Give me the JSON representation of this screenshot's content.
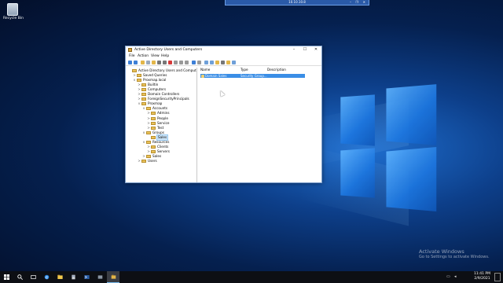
{
  "desktop": {
    "recycle_bin_label": "Recycle Bin"
  },
  "rdp_bar": {
    "title": "10.10.10.8",
    "controls": [
      "–",
      "❐",
      "✕"
    ]
  },
  "window": {
    "title": "Active Directory Users and Computers",
    "menu": [
      "File",
      "Action",
      "View",
      "Help"
    ],
    "tree": [
      {
        "label": "Active Directory Users and Computers [PROXOD...",
        "level": 0,
        "exp": ""
      },
      {
        "label": "Saved Queries",
        "level": 1,
        "exp": ">"
      },
      {
        "label": "Proxmap.local",
        "level": 1,
        "exp": "v"
      },
      {
        "label": "Builtin",
        "level": 2,
        "exp": ">"
      },
      {
        "label": "Computers",
        "level": 2,
        "exp": ">"
      },
      {
        "label": "Domain Controllers",
        "level": 2,
        "exp": ">"
      },
      {
        "label": "ForeignSecurityPrincipals",
        "level": 2,
        "exp": ">"
      },
      {
        "label": "Proxmap",
        "level": 2,
        "exp": "v"
      },
      {
        "label": "Accounts",
        "level": 3,
        "exp": "v"
      },
      {
        "label": "Admins",
        "level": 4,
        "exp": ">"
      },
      {
        "label": "People",
        "level": 4,
        "exp": ">"
      },
      {
        "label": "Service",
        "level": 4,
        "exp": ">"
      },
      {
        "label": "Test",
        "level": 4,
        "exp": ">"
      },
      {
        "label": "Groups",
        "level": 3,
        "exp": "v"
      },
      {
        "label": "Sales",
        "level": 4,
        "exp": "",
        "selected": true
      },
      {
        "label": "Resources",
        "level": 3,
        "exp": "v"
      },
      {
        "label": "Clients",
        "level": 4,
        "exp": ">"
      },
      {
        "label": "Servers",
        "level": 4,
        "exp": ">"
      },
      {
        "label": "Sales",
        "level": 3,
        "exp": ">"
      },
      {
        "label": "Users",
        "level": 2,
        "exp": ">"
      }
    ],
    "columns": [
      "Name",
      "Type",
      "Description"
    ],
    "rows": [
      {
        "name": "Domain Sales",
        "type": "Security Group...",
        "description": ""
      }
    ]
  },
  "watermark": {
    "line1": "Activate Windows",
    "line2": "Go to Settings to activate Windows."
  },
  "taskbar": {
    "time": "11:41 PM",
    "date": "2/9/2021"
  },
  "colors": {
    "selection": "#3a8ee6",
    "taskbar": "#0d0f14",
    "window_border": "#7a9cc9"
  }
}
